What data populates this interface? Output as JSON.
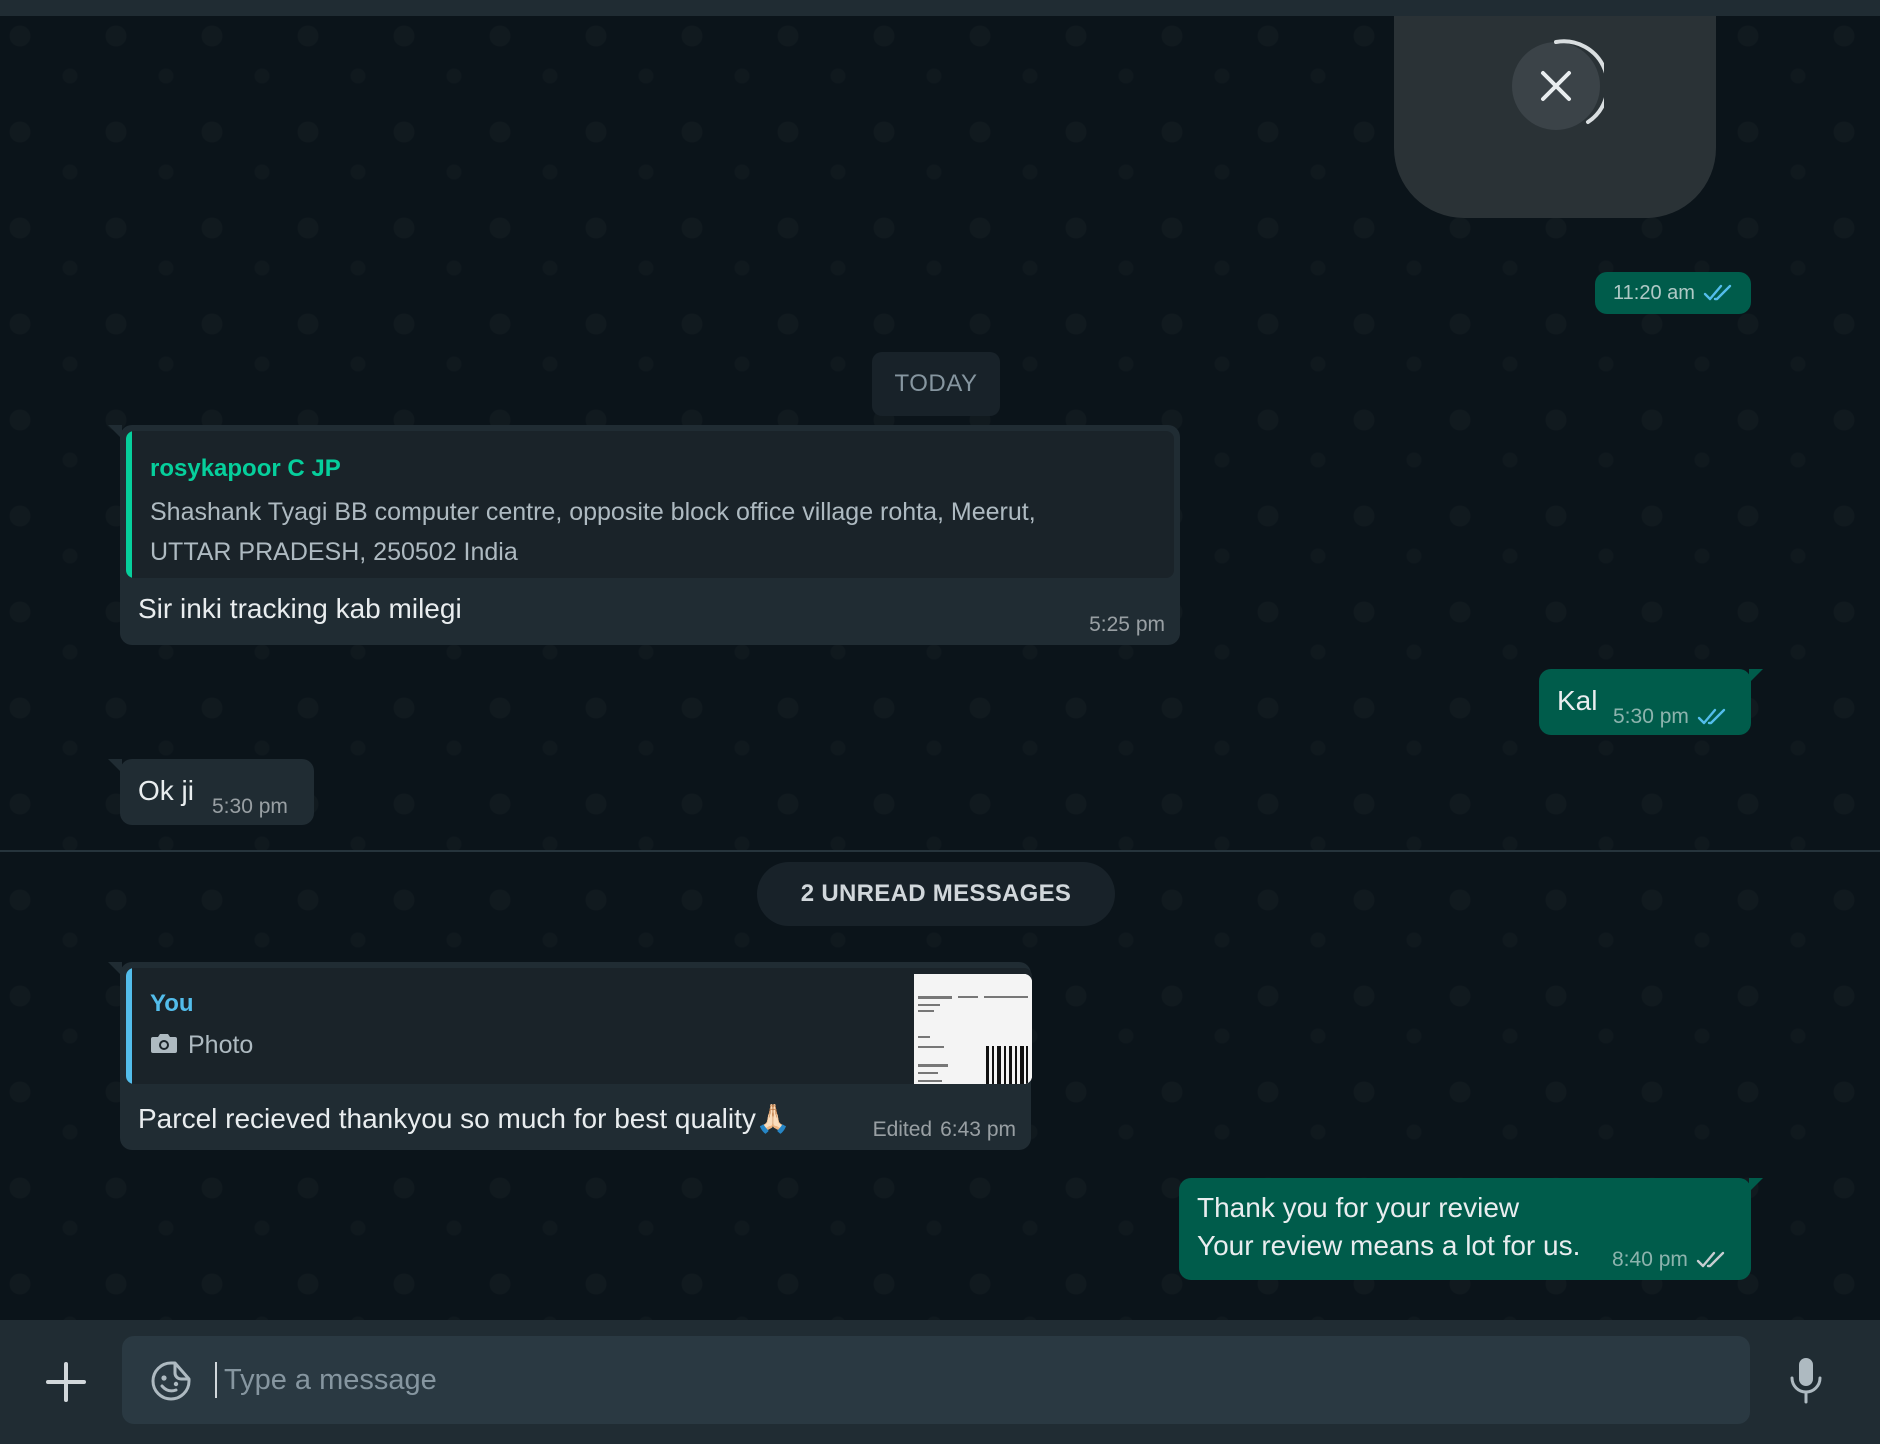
{
  "colors": {
    "chat_bg": "#0b141a",
    "incoming_bubble": "#202c33",
    "outgoing_bubble": "#005c4b",
    "read_tick": "#53bdeb",
    "sent_tick": "#c7cdd1",
    "quote_sender_green": "#06cf9c",
    "quote_sender_blue": "#53bdeb"
  },
  "top_media": {
    "icon": "close-icon"
  },
  "earlier": {
    "time": "11:20 am",
    "status": "read"
  },
  "date_divider": "TODAY",
  "messages": [
    {
      "direction": "incoming",
      "quote": {
        "sender": "rosykapoor C JP",
        "text_line1": "Shashank Tyagi  BB computer centre, opposite block office village rohta, Meerut,",
        "text_line2": "UTTAR PRADESH, 250502 India"
      },
      "text": "Sir inki tracking kab milegi",
      "time": "5:25 pm"
    },
    {
      "direction": "outgoing",
      "text": "Kal",
      "time": "5:30 pm",
      "status": "read"
    },
    {
      "direction": "incoming",
      "text": "Ok ji",
      "time": "5:30 pm"
    },
    {
      "direction": "incoming",
      "quote": {
        "sender": "You",
        "icon": "camera-icon",
        "text": "Photo"
      },
      "text": "Parcel recieved thankyou so much for best quality🙏🏻",
      "edited_label": "Edited",
      "time": "6:43 pm"
    },
    {
      "direction": "outgoing",
      "text_line1": "Thank you for your review",
      "text_line2": "Your review means a lot for us.",
      "time": "8:40 pm",
      "status": "sent"
    }
  ],
  "unread_divider": "2 UNREAD MESSAGES",
  "composer": {
    "placeholder": "Type a message",
    "attach_icon": "plus-icon",
    "emoji_icon": "sticker-icon",
    "voice_icon": "mic-icon"
  }
}
